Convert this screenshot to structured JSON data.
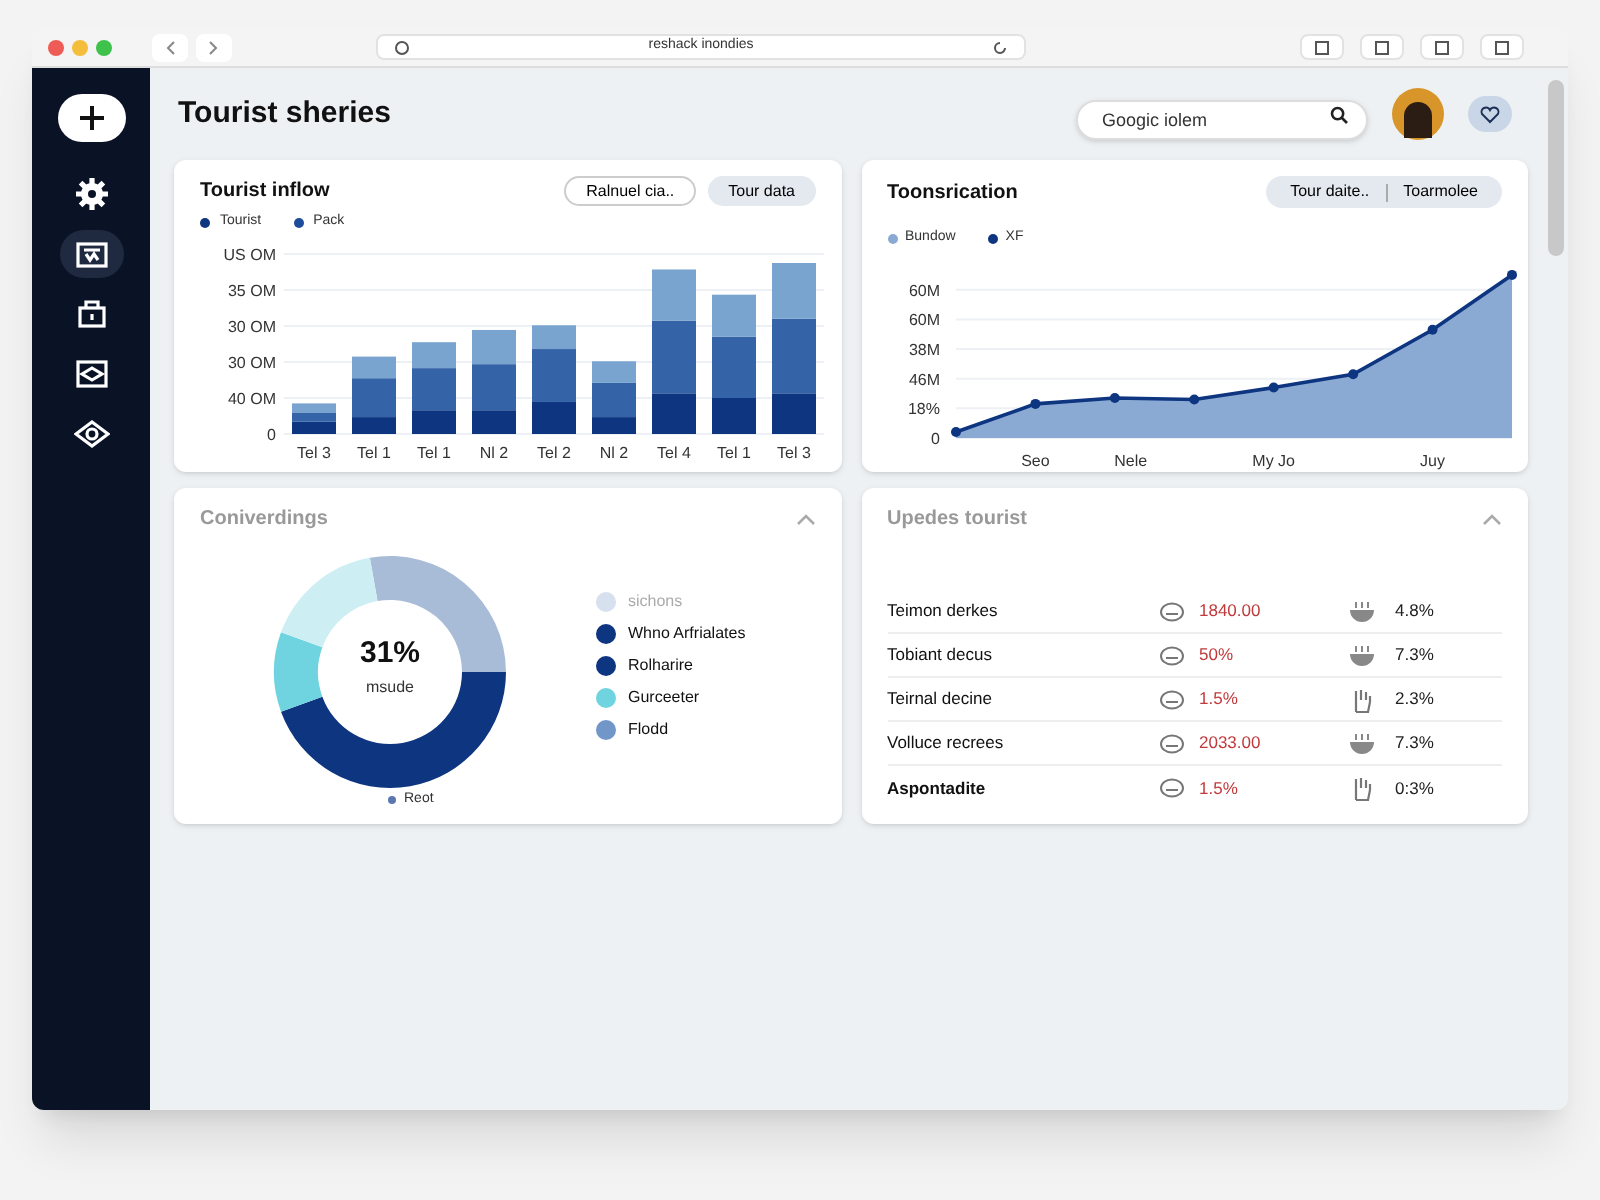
{
  "browser": {
    "address": "reshack inondies"
  },
  "sidebar": {
    "items": [
      {
        "kind": "add",
        "selected": false
      },
      {
        "kind": "gear",
        "selected": false
      },
      {
        "kind": "board",
        "selected": true
      },
      {
        "kind": "bag",
        "selected": false
      },
      {
        "kind": "screen",
        "selected": false
      },
      {
        "kind": "eye",
        "selected": false
      }
    ]
  },
  "header": {
    "title": "Tourist sheries",
    "search": {
      "placeholder": "Googic iolem"
    }
  },
  "inflow_card": {
    "title": "Tourist inflow",
    "buttons": [
      {
        "label": "Ralnuel cia..",
        "selected": false
      },
      {
        "label": "Tour data",
        "selected": true
      }
    ],
    "legend": [
      {
        "label": "Tourist",
        "color": "#0d3580"
      },
      {
        "label": "Pack",
        "color": "#1d4d9a"
      }
    ],
    "y_axis_labels": [
      "US OM",
      "35 OM",
      "30 OM",
      "30 OM",
      "40 OM",
      "0"
    ],
    "x_axis_labels": [
      "Tel 3",
      "Tel 1",
      "Tel 1",
      "Nl 2",
      "Tel 2",
      "Nl 2",
      "Tel 4",
      "Tel 1",
      "Tel 3"
    ]
  },
  "conversion_card": {
    "title": "Toonsrication",
    "tabs": [
      "Tour daite..",
      "Toarmolee"
    ],
    "legend": [
      {
        "label": "Bundow",
        "color": "#8aaad4"
      },
      {
        "label": "XF",
        "color": "#0d3580"
      }
    ],
    "y_axis_labels": [
      "60M",
      "60M",
      "38M",
      "46M",
      "18%",
      "0"
    ],
    "x_axis_labels": [
      "Seo",
      "Nele",
      "My Jo",
      "Juy"
    ]
  },
  "converdings_card": {
    "title": "Coniverdings",
    "center_value": "31%",
    "center_label": "msude",
    "legend": [
      {
        "label": "sichons",
        "color": "#d6e0ee"
      },
      {
        "label": "Whno Arfrialates",
        "color": "#0d3580"
      },
      {
        "label": "Rolharire",
        "color": "#0d3580"
      },
      {
        "label": "Gurceeter",
        "color": "#6fd3e0"
      },
      {
        "label": "Flodd",
        "color": "#7097c8"
      }
    ],
    "footer_legend": {
      "label": "Reot",
      "color": "#5a78b0"
    }
  },
  "updates_card": {
    "title": "Upedes tourist",
    "rows": [
      {
        "kind": "bowl",
        "name": "Teimon derkes",
        "value": "1840.00",
        "share": "4.8%",
        "bold": false
      },
      {
        "kind": "bowl",
        "name": "Tobiant decus",
        "value": "50%",
        "share": "7.3%",
        "bold": false
      },
      {
        "kind": "hand",
        "name": "Teirnal decine",
        "value": "1.5%",
        "share": "2.3%",
        "bold": false
      },
      {
        "kind": "bowl",
        "name": "Volluce recrees",
        "value": "2033.00",
        "share": "7.3%",
        "bold": false
      },
      {
        "kind": "hand",
        "name": "Aspontadite",
        "value": "1.5%",
        "share": "0:3%",
        "bold": true
      }
    ]
  }
}
